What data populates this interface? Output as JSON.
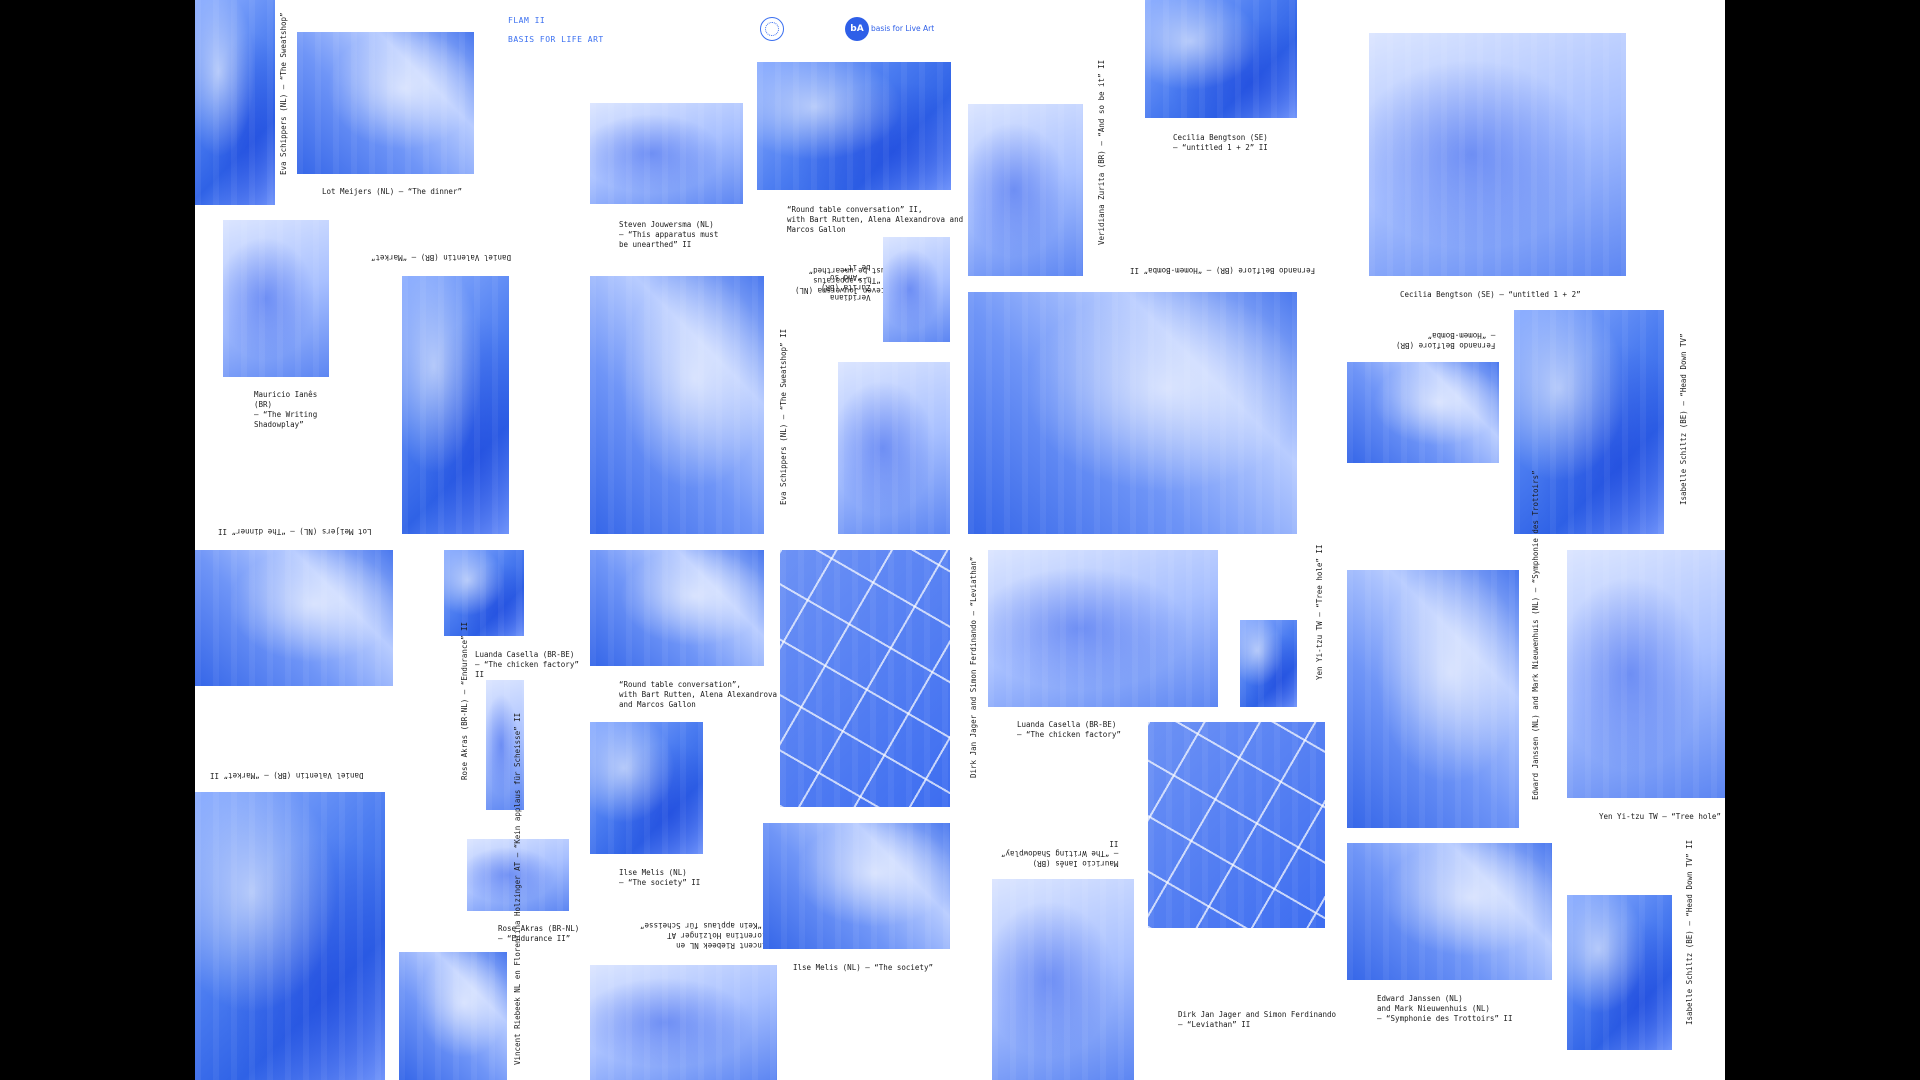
{
  "header": {
    "event": "FLAM II",
    "org_line": "BASIS FOR LIFE ART",
    "logo_mark": "bA",
    "logo_text": "basis for Live Art"
  },
  "captions": {
    "c1": "Eva Schippers (NL) – “The Sweatshop”",
    "c2": "Lot Meijers (NL) – “The dinner”",
    "c3": "Steven Jouwersma (NL)\n– “This apparatus must\nbe unearthed” II",
    "c4": "“Round table conversation” II,\nwith Bart Rutten, Alena Alexandrova and\nMarcos Gallon",
    "c5": "Veridiana Zurita (BR)\n– “And so be it” II",
    "c6": "Cecilia Bengtson (SE)\n– “untitled 1 + 2” II",
    "c7": "Cecilia Bengtson (SE) – “untitled 1 + 2”",
    "c8": "Daniel Valentin (BR) – “Market”",
    "c9": "Mauricio Ianês\n(BR)\n– “The Writing\nShadowplay”",
    "c10": "Fernando Belfiore (BR) – “Homem-Bomba” II",
    "c11": "Veridiana\nZurita (BR)\n– “And so\nbe it”",
    "c12": "Eva Schippers (NL) – “The Sweatshop” II",
    "c13": "Steven Jouwersma (NL)\n– “This apparatus\nmust be unearthed”",
    "c14": "Fernando Belfiore (BR)\n– “Homem-Bomba”",
    "c15": "Isabelle Schiltz (BE) – “Head Down TV”",
    "c16": "Lot Meijers (NL) – “The dinner” II",
    "c17": "Luanda Casella (BR-BE)\n– “The chicken factory”\nII",
    "c18": "“Round table conversation”,\nwith Bart Rutten, Alena Alexandrova\nand Marcos Gallon",
    "c19": "Dirk Jan Jager and Simon Ferdinando – “Leviathan”",
    "c20": "Luanda Casella (BR-BE)\n– “The chicken factory”",
    "c21": "Yen Yi-tzu TW\n– “Tree hole” II",
    "c22": "Edward Janssen (NL) and Mark Nieuwenhuis (NL)\n– “Symphonie des Trottoirs”",
    "c23": "Yen Yi-tzu TW – “Tree hole”",
    "c24": "Daniel Valentin (BR) – “Market” II",
    "c25": "Rose Akras (BR-NL)\n– “Endurance” II",
    "c26": "Ilse Melis (NL)\n– “The society” II",
    "c27": "Rose Akras (BR-NL)\n– “Endurance II”",
    "c28": "Vincent Riebeek NL en\nFlorentina Holzinger AT\n– “Kein applaus für Scheisse”",
    "c29": "Ilse Melis (NL) – “The society”",
    "c30": "Mauricio Ianês (BR)\n– “The Writing Shadowplay”\nII",
    "c31": "Dirk Jan Jager and Simon Ferdinando\n– “Leviathan” II",
    "c32": "Edward Janssen (NL)\nand Mark Nieuwenhuis (NL)\n– “Symphonie des Trottoirs” II",
    "c33": "Isabelle Schiltz (BE)\n– “Head Down TV” II",
    "c34": "Vincent Riebeek NL en\nFlorentina Holzinger\nAT – “Kein applaus für\nScheisse” II"
  },
  "colors": {
    "background": "#000000",
    "poster": "#ffffff",
    "duotone_blue": "#3a6ff0",
    "caption_text": "#1a1a1a"
  },
  "icons": {
    "seal": "circular-seal-icon",
    "logo": "basis-logo-icon"
  }
}
